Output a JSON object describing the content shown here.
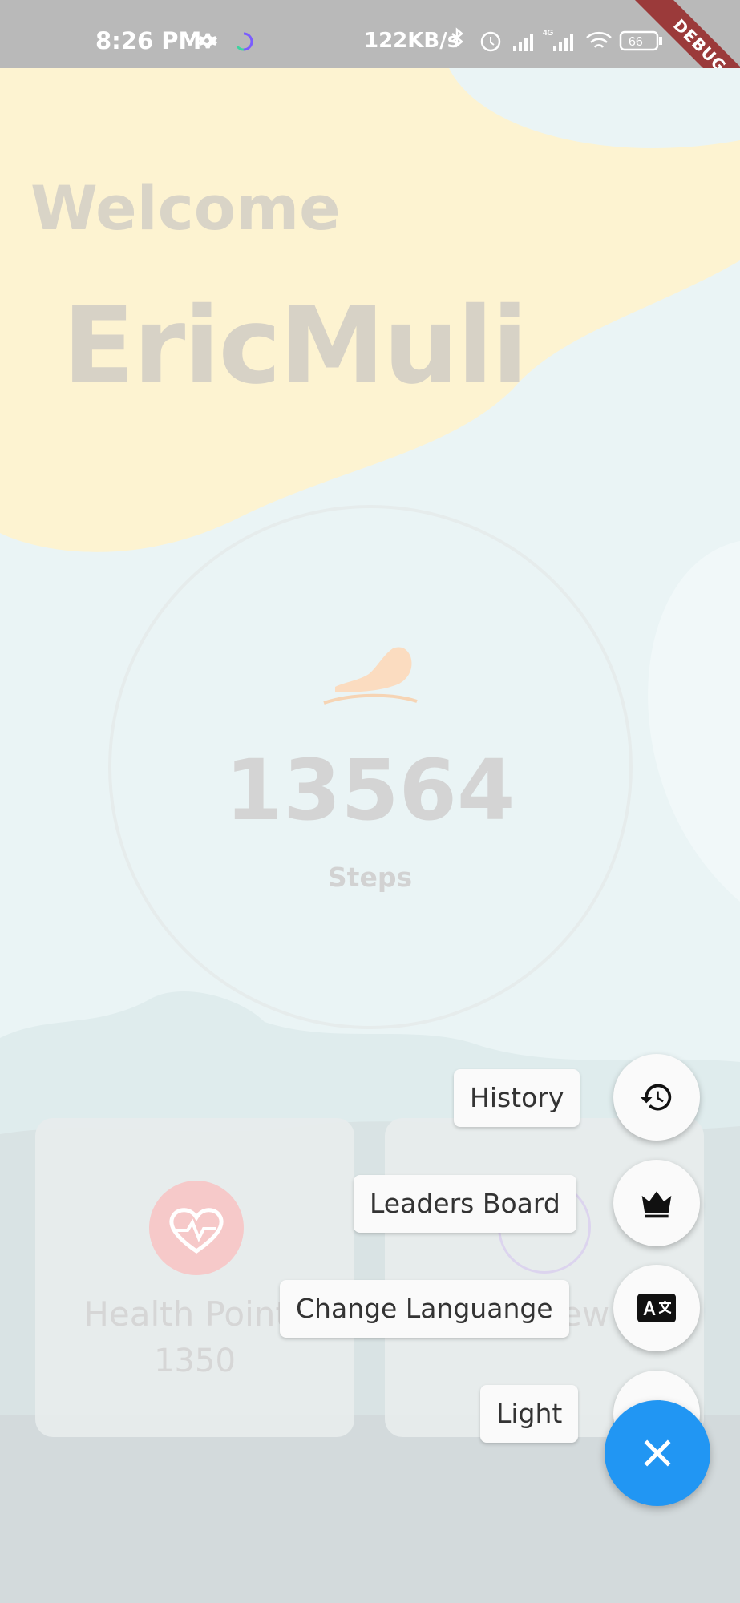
{
  "status_bar": {
    "time": "8:26 PM",
    "network_speed": "122KB/s",
    "battery": "66",
    "network_type": "4G",
    "debug_banner": "DEBUG",
    "icons": [
      "settings-icon",
      "app-spinner-icon",
      "bluetooth-icon",
      "alarm-icon",
      "signal-icon",
      "signal-4g-icon",
      "wifi-icon",
      "battery-icon"
    ]
  },
  "greeting": {
    "welcome": "Welcome",
    "username": "EricMuli"
  },
  "steps": {
    "count": "13564",
    "label": "Steps",
    "icon": "shoe-icon"
  },
  "cards": {
    "health": {
      "title": "Health Points",
      "value": "1350",
      "icon": "heart-pulse-icon"
    },
    "review": {
      "title_visible_fragment": "ew",
      "icon": "review-icon"
    }
  },
  "speed_dial": {
    "items": [
      {
        "label": "History",
        "icon": "history-icon"
      },
      {
        "label": "Leaders Board",
        "icon": "crown-icon"
      },
      {
        "label": "Change Languange",
        "icon": "translate-icon"
      },
      {
        "label": "Light",
        "icon": "moon-icon"
      }
    ],
    "close_icon": "close-icon"
  },
  "colors": {
    "fab_blue": "#2196f3",
    "status_bar": "#b9b9b9",
    "blob_yellow": "#fdf3d1"
  }
}
